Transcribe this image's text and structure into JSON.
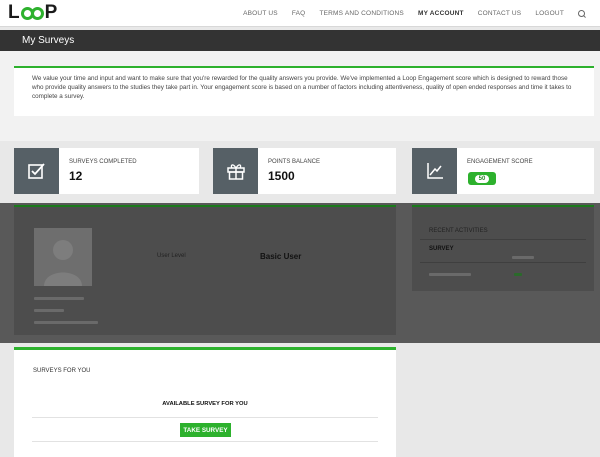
{
  "header": {
    "logo": {
      "l": "L",
      "p": "P"
    },
    "nav": [
      "ABOUT US",
      "FAQ",
      "TERMS AND CONDITIONS",
      "MY ACCOUNT",
      "CONTACT US",
      "LOGOUT"
    ],
    "active_nav": "MY ACCOUNT"
  },
  "page_title": "My Surveys",
  "intro_text": "We value your time and input and want to make sure that you're rewarded for the quality answers you provide. We've implemented a Loop Engagement score which is designed to reward those who provide quality answers to the studies they take part in. Your engagement score is based on a number of factors including attentiveness, quality of open ended responses and time it takes to complete a survey.",
  "stats": {
    "surveys_completed": {
      "label": "SURVEYS COMPLETED",
      "value": "12",
      "icon": "check-icon"
    },
    "points_balance": {
      "label": "POINTS BALANCE",
      "value": "1500",
      "icon": "gift-icon"
    },
    "engagement_score": {
      "label": "ENGAGEMENT SCORE",
      "value": "50",
      "icon": "chart-trend-icon"
    }
  },
  "profile": {
    "user_level_label": "User Level",
    "user_level_value": "Basic User"
  },
  "recent": {
    "title": "RECENT ACTIVITIES",
    "column": "SURVEY"
  },
  "surveys": {
    "title": "SURVEYS FOR YOU",
    "available": "AVAILABLE SURVEY FOR YOU",
    "button": "TAKE SURVEY"
  },
  "colors": {
    "accent": "#2db12d",
    "dark_bar": "#333333",
    "icon_tile": "#566066",
    "overlay": "#595959"
  }
}
